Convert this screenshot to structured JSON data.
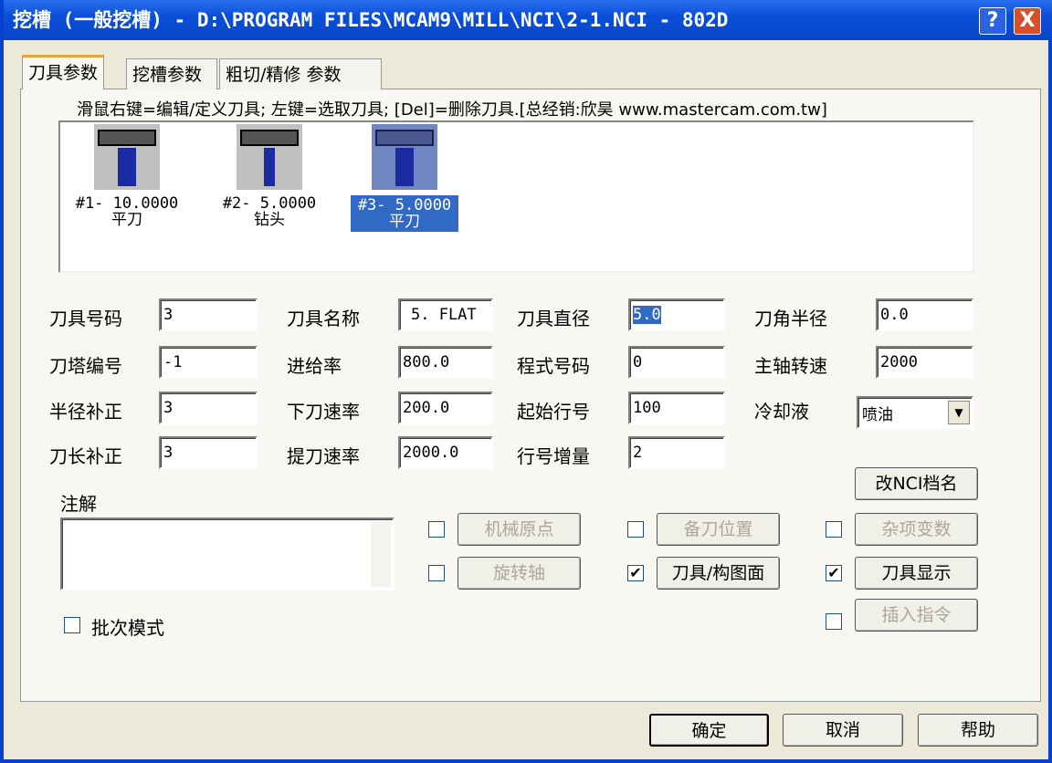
{
  "window": {
    "title": "挖槽 (一般挖槽) - D:\\PROGRAM FILES\\MCAM9\\MILL\\NCI\\2-1.NCI - 802D",
    "help": "?",
    "close": "X"
  },
  "tabs": [
    "刀具参数",
    "挖槽参数",
    "粗切/精修 参数"
  ],
  "hint": "滑鼠右键=编辑/定义刀具; 左键=选取刀具; [Del]=删除刀具.[总经销:欣昊 www.mastercam.com.tw]",
  "tools": [
    {
      "num": "#1- 10.0000",
      "type": "平刀"
    },
    {
      "num": "#2- 5.0000",
      "type": "钻头"
    },
    {
      "num": "#3- 5.0000",
      "type": "平刀",
      "selected": true
    }
  ],
  "fields": {
    "tool_number": {
      "label": "刀具号码",
      "value": "3"
    },
    "tool_name": {
      "label": "刀具名称",
      "value": "5. FLAT"
    },
    "tool_diameter": {
      "label": "刀具直径",
      "value": "5.0"
    },
    "corner_radius": {
      "label": "刀角半径",
      "value": "0.0"
    },
    "turret": {
      "label": "刀塔编号",
      "value": "-1"
    },
    "feed_rate": {
      "label": "进给率",
      "value": "800.0"
    },
    "program_number": {
      "label": "程式号码",
      "value": "0"
    },
    "spindle_speed": {
      "label": "主轴转速",
      "value": "2000"
    },
    "dia_offset": {
      "label": "半径补正",
      "value": "3"
    },
    "plunge_rate": {
      "label": "下刀速率",
      "value": "200.0"
    },
    "start_seq": {
      "label": "起始行号",
      "value": "100"
    },
    "coolant": {
      "label": "冷却液",
      "value": "喷油"
    },
    "len_offset": {
      "label": "刀长补正",
      "value": "3"
    },
    "retract_rate": {
      "label": "提刀速率",
      "value": "2000.0"
    },
    "seq_inc": {
      "label": "行号增量",
      "value": "2"
    }
  },
  "comment_label": "注解",
  "buttons": {
    "rename_nci": "改NCI档名",
    "home": "机械原点",
    "ref_point": "备刀位置",
    "misc": "杂项变数",
    "rotary": "旋转轴",
    "tool_plane": "刀具/构图面",
    "tool_display": "刀具显示",
    "insert": "插入指令",
    "batch": "批次模式"
  },
  "footer": {
    "ok": "确定",
    "cancel": "取消",
    "help": "帮助"
  }
}
